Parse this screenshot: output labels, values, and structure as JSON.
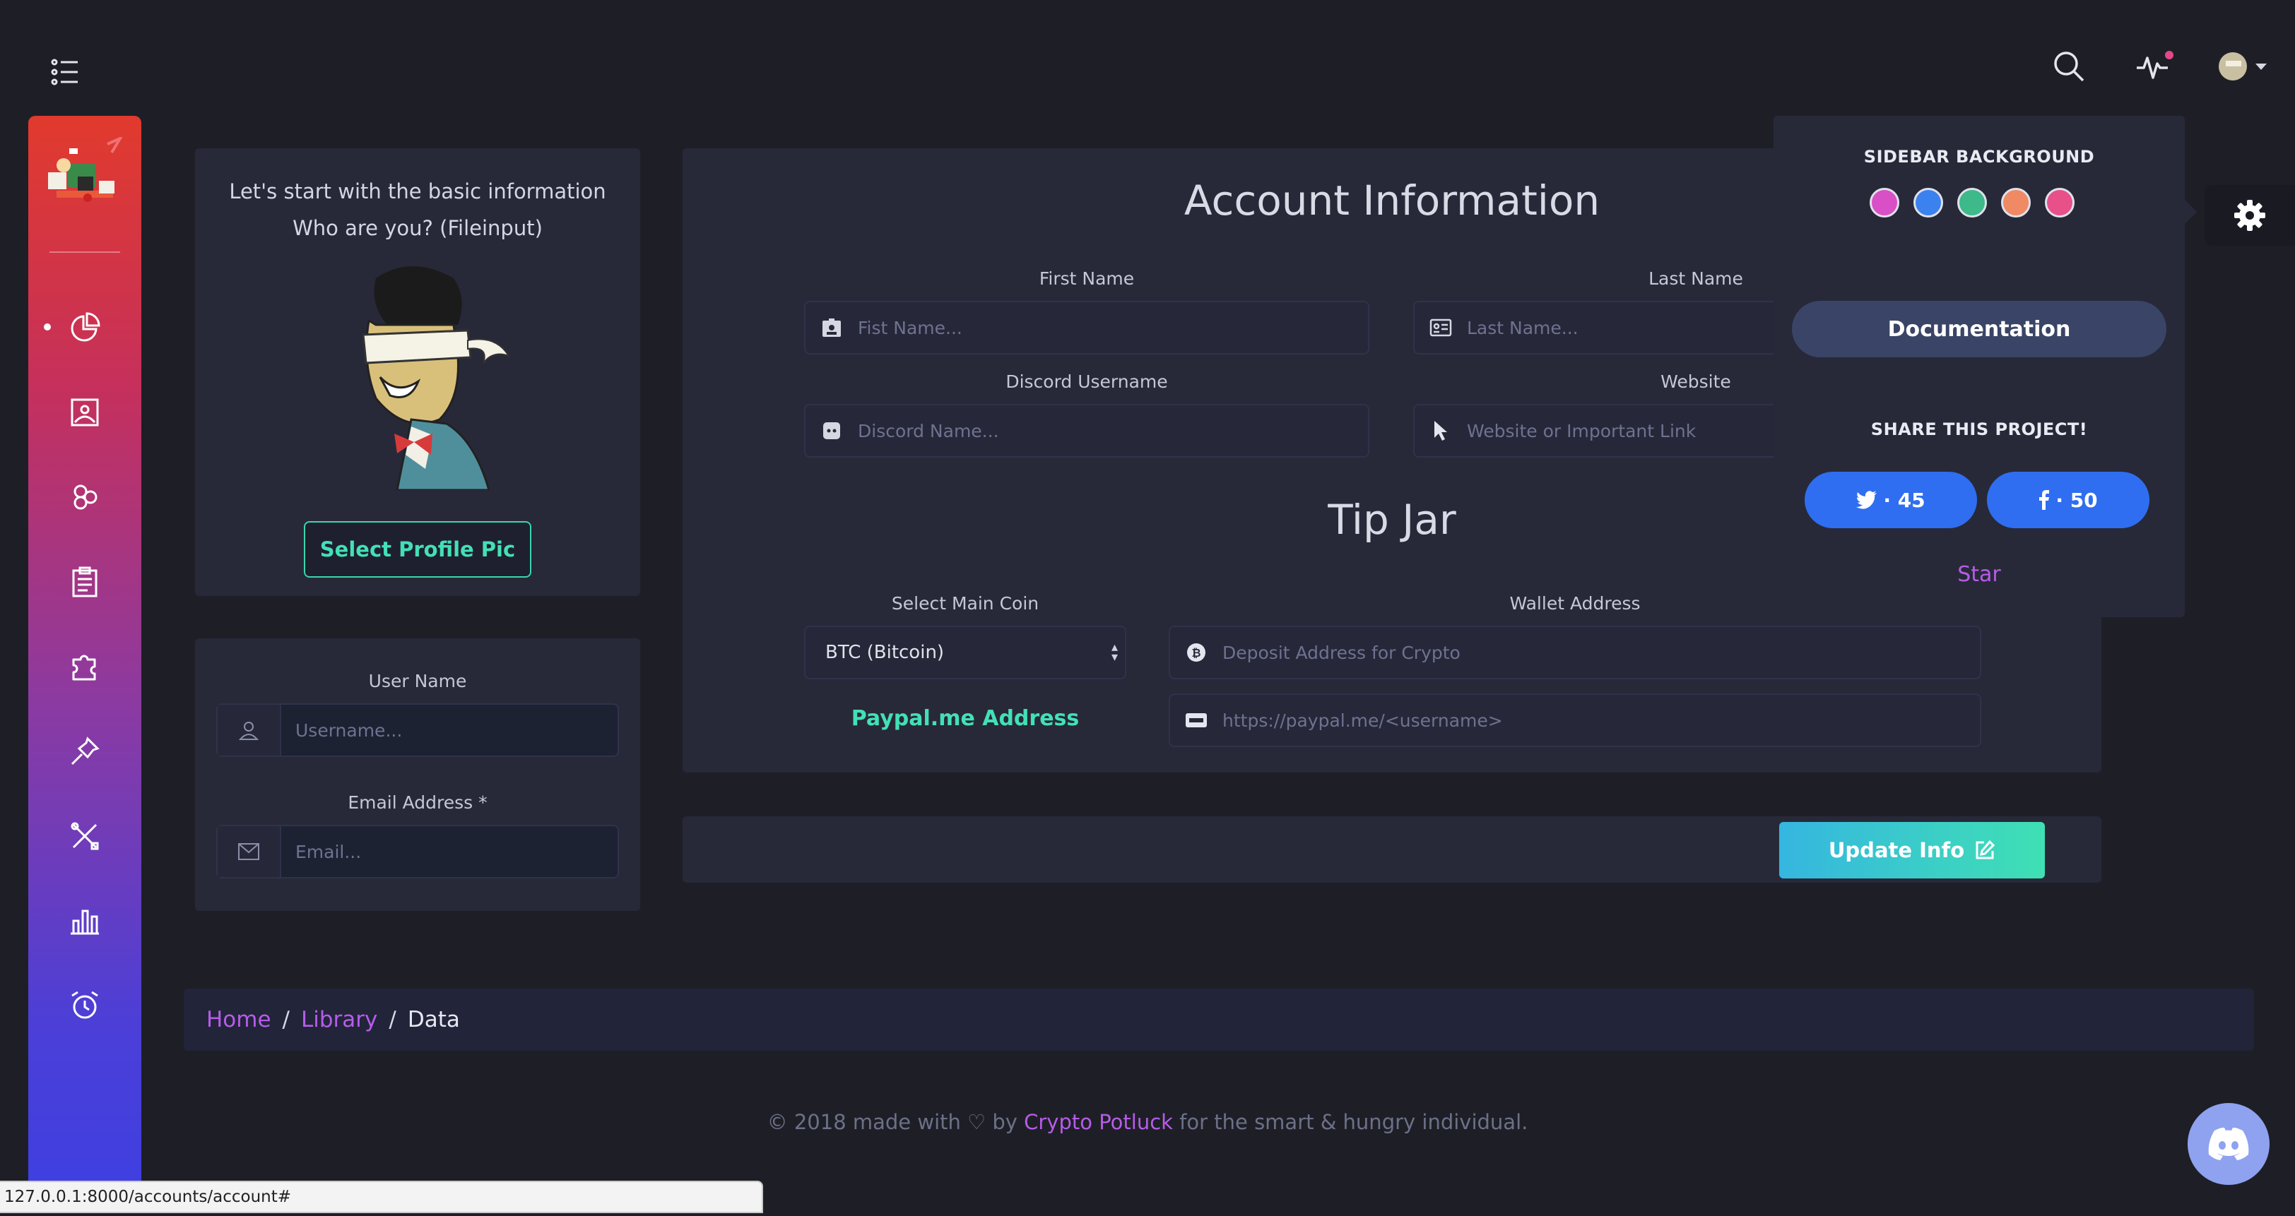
{
  "topbar": {
    "menu_icon": "list-icon",
    "search_icon": "search-icon",
    "activity_icon": "activity-pulse-icon",
    "notification_dot_color": "#e4478a"
  },
  "sidebar": {
    "gradient": [
      "#e13a2d",
      "#c6305b",
      "#8b3aa2",
      "#4b3fd8"
    ],
    "items": [
      {
        "name": "dashboard",
        "icon": "pie-chart-icon",
        "active": true
      },
      {
        "name": "gallery",
        "icon": "image-icon"
      },
      {
        "name": "components",
        "icon": "hexagons-icon"
      },
      {
        "name": "forms",
        "icon": "clipboard-icon"
      },
      {
        "name": "plugins",
        "icon": "puzzle-icon"
      },
      {
        "name": "pins",
        "icon": "pin-icon"
      },
      {
        "name": "tools",
        "icon": "tools-icon"
      },
      {
        "name": "charts",
        "icon": "bar-chart-icon"
      },
      {
        "name": "calendar",
        "icon": "alarm-clock-icon"
      }
    ]
  },
  "profile_card": {
    "line1": "Let's start with the basic information",
    "line2": "Who are you? (Fileinput)",
    "select_button": "Select Profile Pic"
  },
  "user_card": {
    "username_label": "User Name",
    "username_placeholder": "Username...",
    "email_label": "Email Address *",
    "email_placeholder": "Email..."
  },
  "account": {
    "title": "Account Information",
    "first_name_label": "First Name",
    "first_name_placeholder": "Fist Name...",
    "last_name_label": "Last Name",
    "last_name_placeholder": "Last Name...",
    "discord_label": "Discord Username",
    "discord_placeholder": "Discord Name...",
    "website_label": "Website",
    "website_placeholder": "Website or Important Link",
    "tip_title": "Tip Jar",
    "coin_label": "Select Main Coin",
    "coin_selected": "BTC (Bitcoin)",
    "wallet_label": "Wallet Address",
    "wallet_placeholder": "Deposit Address for Crypto",
    "paypal_label": "Paypal.me Address",
    "paypal_placeholder": "https://paypal.me/<username>"
  },
  "update": {
    "button": "Update Info",
    "accent_from": "#35b6e0",
    "accent_to": "#3fe0b4"
  },
  "breadcrumb": {
    "home": "Home",
    "library": "Library",
    "current": "Data"
  },
  "footer": {
    "prefix": "© 2018 made with",
    "by": "by",
    "brand": "Crypto Potluck",
    "suffix": "for the smart & hungry individual."
  },
  "settings": {
    "bg_heading": "SIDEBAR BACKGROUND",
    "swatches": [
      "#d94fc6",
      "#3b82f0",
      "#3db98a",
      "#ef8a64",
      "#e8508a"
    ],
    "documentation": "Documentation",
    "share_heading": "SHARE THIS PROJECT!",
    "twitter_count": "· 45",
    "facebook_count": "· 50",
    "star": "Star"
  },
  "statusbar": {
    "url": "127.0.0.1:8000/accounts/account#"
  }
}
